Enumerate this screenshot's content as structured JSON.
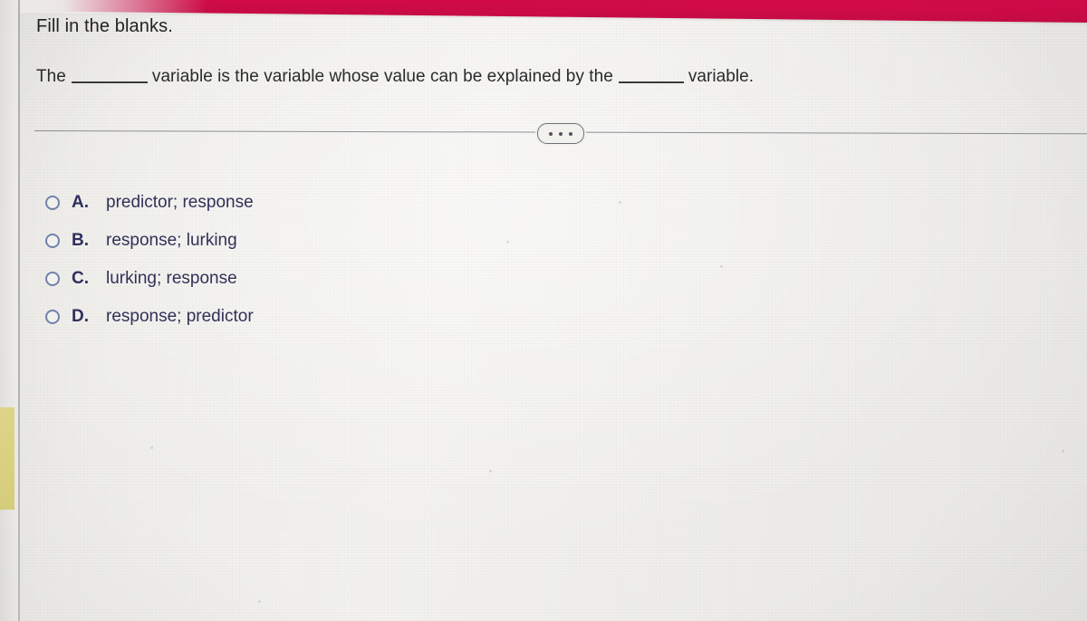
{
  "banner": {
    "color": "#cf0b47"
  },
  "question": {
    "prompt": "Fill in the blanks.",
    "text_before_first_blank": "The",
    "text_between_blanks": "variable is the variable whose value can be explained by the",
    "text_after_second_blank": "variable."
  },
  "divider": {
    "more_button_label": "...",
    "more_button_name": "more-options-ellipsis"
  },
  "options": [
    {
      "letter": "A.",
      "text": "predictor; response",
      "selected": false
    },
    {
      "letter": "B.",
      "text": "response; lurking",
      "selected": false
    },
    {
      "letter": "C.",
      "text": "lurking; response",
      "selected": false
    },
    {
      "letter": "D.",
      "text": "response; predictor",
      "selected": false
    }
  ],
  "colors": {
    "page_background": "#eeedea",
    "banner": "#cf0b47",
    "text": "#2b2b2b",
    "option_text": "#313158",
    "radio_outline": "#7182ab",
    "divider": "#8e8f93",
    "margin_highlight": "#ddd383"
  }
}
